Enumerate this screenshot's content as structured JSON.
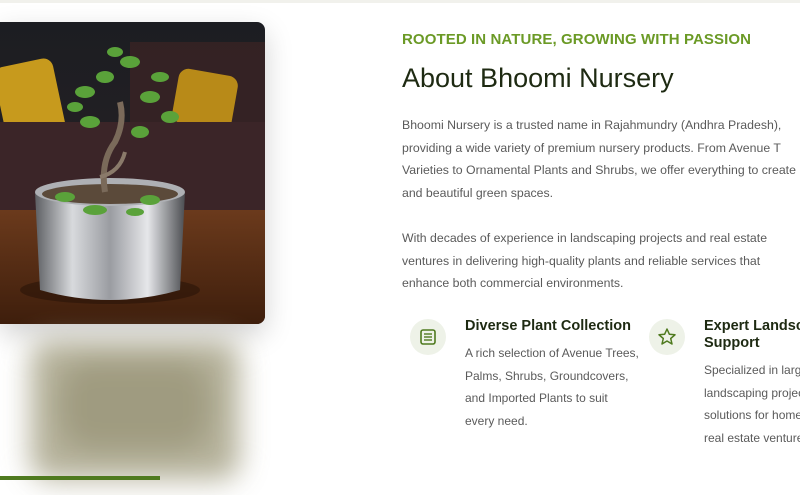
{
  "about": {
    "eyebrow": "ROOTED IN NATURE, GROWING WITH PASSION",
    "title": "About Bhoomi Nursery",
    "paragraph1": "Bhoomi Nursery is a trusted name in Rajahmundry (Andhra Pradesh), providing a wide variety of premium nursery products. From Avenue T Varieties to Ornamental Plants and Shrubs, we offer everything to create l and beautiful green spaces.",
    "paragraph2": "With decades of experience in landscaping projects and real estate ventures in delivering high-quality plants and reliable services that enhance both commercial environments."
  },
  "features": [
    {
      "icon": "list-icon",
      "title": "Diverse Plant Collection",
      "description": "A rich selection of Avenue Trees, Palms, Shrubs, Groundcovers, and Imported Plants to suit every need."
    },
    {
      "icon": "star-icon",
      "title": "Expert Landsc Support",
      "description_lines": [
        "Specialized in large",
        "landscaping projec",
        "solutions for home",
        "real estate venture"
      ]
    }
  ],
  "colors": {
    "accent_green": "#6b9a26",
    "dark_text": "#1e2a12",
    "body_text": "#5a5a5a",
    "icon_bg": "#eef2e8"
  }
}
